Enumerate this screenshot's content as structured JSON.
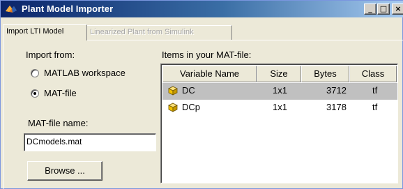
{
  "window": {
    "title": "Plant Model Importer",
    "controls": {
      "minimize": "_",
      "maximize": "□",
      "close": "×"
    }
  },
  "tabs": [
    {
      "label": "Import LTI Model",
      "active": true
    },
    {
      "label": "Linearized Plant from Simulink",
      "active": false
    }
  ],
  "import_from": {
    "label": "Import from:",
    "options": [
      {
        "label": "MATLAB workspace",
        "selected": false
      },
      {
        "label": "MAT-file",
        "selected": true
      }
    ]
  },
  "matfile": {
    "label": "MAT-file name:",
    "value": "DCmodels.mat",
    "browse_label": "Browse ..."
  },
  "items": {
    "label": "Items in your MAT-file:",
    "columns": [
      "Variable Name",
      "Size",
      "Bytes",
      "Class"
    ],
    "rows": [
      {
        "name": "DC",
        "size": "1x1",
        "bytes": "3712",
        "class": "tf",
        "selected": true
      },
      {
        "name": "DCp",
        "size": "1x1",
        "bytes": "3178",
        "class": "tf",
        "selected": false
      }
    ]
  },
  "icons": {
    "app": "matlab-membrane-icon",
    "variable": "cube-icon"
  },
  "colors": {
    "titlebar_start": "#0a246a",
    "titlebar_end": "#a6caf0",
    "panel": "#ece9d8",
    "selected_row": "#c0c0c0",
    "cube_yellow": "#f2c200"
  }
}
